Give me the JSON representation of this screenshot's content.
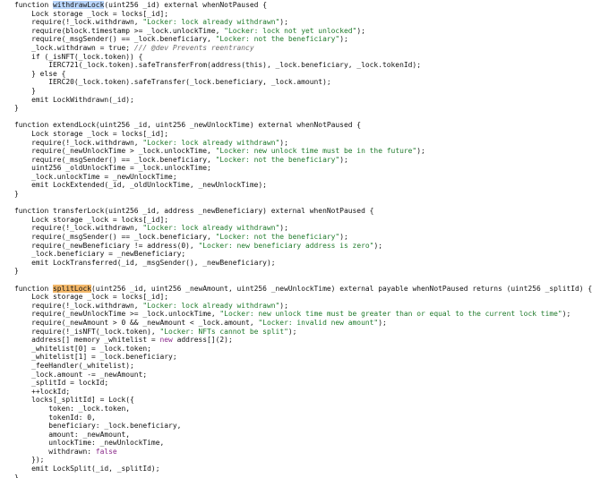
{
  "code_lines": [
    [
      {
        "t": "function "
      },
      {
        "t": "withdrawLock",
        "c": "hl1"
      },
      {
        "t": "(uint256 _id) external whenNotPaused {"
      }
    ],
    [
      {
        "t": "    Lock storage _lock = locks[_id];"
      }
    ],
    [
      {
        "t": "    require(!_lock.withdrawn, "
      },
      {
        "t": "\"Locker: lock already withdrawn\"",
        "c": "str"
      },
      {
        "t": ");"
      }
    ],
    [
      {
        "t": "    require(block.timestamp >= _lock.unlockTime, "
      },
      {
        "t": "\"Locker: lock not yet unlocked\"",
        "c": "str"
      },
      {
        "t": ");"
      }
    ],
    [
      {
        "t": "    require(_msgSender() == _lock.beneficiary, "
      },
      {
        "t": "\"Locker: not the beneficiary\"",
        "c": "str"
      },
      {
        "t": ");"
      }
    ],
    [
      {
        "t": "    _lock.withdrawn = true; "
      },
      {
        "t": "/// @dev Prevents reentrancy",
        "c": "cmt"
      }
    ],
    [
      {
        "t": "    if (_isNFT(_lock.token)) {"
      }
    ],
    [
      {
        "t": "        IERC721(_lock.token).safeTransferFrom(address(this), _lock.beneficiary, _lock.tokenId);"
      }
    ],
    [
      {
        "t": "    } else {"
      }
    ],
    [
      {
        "t": "        IERC20(_lock.token).safeTransfer(_lock.beneficiary, _lock.amount);"
      }
    ],
    [
      {
        "t": "    }"
      }
    ],
    [
      {
        "t": "    emit LockWithdrawn(_id);"
      }
    ],
    [
      {
        "t": "}"
      }
    ],
    [
      {
        "t": ""
      }
    ],
    [
      {
        "t": "function extendLock(uint256 _id, uint256 _newUnlockTime) external whenNotPaused {"
      }
    ],
    [
      {
        "t": "    Lock storage _lock = locks[_id];"
      }
    ],
    [
      {
        "t": "    require(!_lock.withdrawn, "
      },
      {
        "t": "\"Locker: lock already withdrawn\"",
        "c": "str"
      },
      {
        "t": ");"
      }
    ],
    [
      {
        "t": "    require(_newUnlockTime > _lock.unlockTime, "
      },
      {
        "t": "\"Locker: new unlock time must be in the future\"",
        "c": "str"
      },
      {
        "t": ");"
      }
    ],
    [
      {
        "t": "    require(_msgSender() == _lock.beneficiary, "
      },
      {
        "t": "\"Locker: not the beneficiary\"",
        "c": "str"
      },
      {
        "t": ");"
      }
    ],
    [
      {
        "t": "    uint256 _oldUnlockTime = _lock.unlockTime;"
      }
    ],
    [
      {
        "t": "    _lock.unlockTime = _newUnlockTime;"
      }
    ],
    [
      {
        "t": "    emit LockExtended(_id, _oldUnlockTime, _newUnlockTime);"
      }
    ],
    [
      {
        "t": "}"
      }
    ],
    [
      {
        "t": ""
      }
    ],
    [
      {
        "t": "function transferLock(uint256 _id, address _newBeneficiary) external whenNotPaused {"
      }
    ],
    [
      {
        "t": "    Lock storage _lock = locks[_id];"
      }
    ],
    [
      {
        "t": "    require(!_lock.withdrawn, "
      },
      {
        "t": "\"Locker: lock already withdrawn\"",
        "c": "str"
      },
      {
        "t": ");"
      }
    ],
    [
      {
        "t": "    require(_msgSender() == _lock.beneficiary, "
      },
      {
        "t": "\"Locker: not the beneficiary\"",
        "c": "str"
      },
      {
        "t": ");"
      }
    ],
    [
      {
        "t": "    require(_newBeneficiary != address(0), "
      },
      {
        "t": "\"Locker: new beneficiary address is zero\"",
        "c": "str"
      },
      {
        "t": ");"
      }
    ],
    [
      {
        "t": "    _lock.beneficiary = _newBeneficiary;"
      }
    ],
    [
      {
        "t": "    emit LockTransferred(_id, _msgSender(), _newBeneficiary);"
      }
    ],
    [
      {
        "t": "}"
      }
    ],
    [
      {
        "t": ""
      }
    ],
    [
      {
        "t": "function "
      },
      {
        "t": "splitLock",
        "c": "hl2"
      },
      {
        "t": "(uint256 _id, uint256 _newAmount, uint256 _newUnlockTime) external payable whenNotPaused returns (uint256 _splitId) {"
      }
    ],
    [
      {
        "t": "    Lock storage _lock = locks[_id];"
      }
    ],
    [
      {
        "t": "    require(!_lock.withdrawn, "
      },
      {
        "t": "\"Locker: lock already withdrawn\"",
        "c": "str"
      },
      {
        "t": ");"
      }
    ],
    [
      {
        "t": "    require(_newUnlockTime >= _lock.unlockTime, "
      },
      {
        "t": "\"Locker: new unlock time must be greater than or equal to the current lock time\"",
        "c": "str"
      },
      {
        "t": ");"
      }
    ],
    [
      {
        "t": "    require(_newAmount > 0 && _newAmount < _lock.amount, "
      },
      {
        "t": "\"Locker: invalid new amount\"",
        "c": "str"
      },
      {
        "t": ");"
      }
    ],
    [
      {
        "t": "    require(!_isNFT(_lock.token), "
      },
      {
        "t": "\"Locker: NFTs cannot be split\"",
        "c": "str"
      },
      {
        "t": ");"
      }
    ],
    [
      {
        "t": "    address[] memory _whitelist = "
      },
      {
        "t": "new",
        "c": "lit"
      },
      {
        "t": " address[](2);"
      }
    ],
    [
      {
        "t": "    _whitelist[0] = _lock.token;"
      }
    ],
    [
      {
        "t": "    _whitelist[1] = _lock.beneficiary;"
      }
    ],
    [
      {
        "t": "    _feeHandler(_whitelist);"
      }
    ],
    [
      {
        "t": "    _lock.amount -= _newAmount;"
      }
    ],
    [
      {
        "t": "    _splitId = lockId;"
      }
    ],
    [
      {
        "t": "    ++lockId;"
      }
    ],
    [
      {
        "t": "    locks[_splitId] = Lock({"
      }
    ],
    [
      {
        "t": "        token: _lock.token,"
      }
    ],
    [
      {
        "t": "        tokenId: 0,"
      }
    ],
    [
      {
        "t": "        beneficiary: _lock.beneficiary,"
      }
    ],
    [
      {
        "t": "        amount: _newAmount,"
      }
    ],
    [
      {
        "t": "        unlockTime: _newUnlockTime,"
      }
    ],
    [
      {
        "t": "        withdrawn: "
      },
      {
        "t": "false",
        "c": "lit"
      }
    ],
    [
      {
        "t": "    });"
      }
    ],
    [
      {
        "t": "    emit LockSplit(_id, _splitId);"
      }
    ],
    [
      {
        "t": "}"
      }
    ]
  ]
}
